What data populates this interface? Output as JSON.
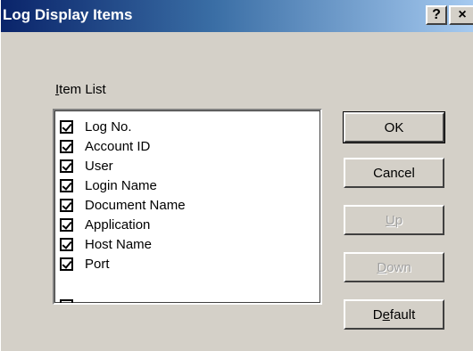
{
  "window": {
    "title": "Log Display Items",
    "help_label": "?",
    "close_label": "×"
  },
  "item_list": {
    "label_mnemonic": "I",
    "label_rest": "tem List",
    "items": [
      {
        "label": "Log No.",
        "checked": true
      },
      {
        "label": "Account ID",
        "checked": true
      },
      {
        "label": "User",
        "checked": true
      },
      {
        "label": "Login Name",
        "checked": true
      },
      {
        "label": "Document Name",
        "checked": true
      },
      {
        "label": "Application",
        "checked": true
      },
      {
        "label": "Host Name",
        "checked": true
      },
      {
        "label": "Port",
        "checked": true
      }
    ]
  },
  "buttons": {
    "ok": "OK",
    "cancel": "Cancel",
    "up_mnemonic": "U",
    "up_rest": "p",
    "down_mnemonic": "D",
    "down_rest": "own",
    "default_pre": "D",
    "default_mnemonic": "e",
    "default_rest": "fault"
  },
  "colors": {
    "dialog_face": "#d4d0c8",
    "title_gradient_start": "#0a246a",
    "title_gradient_end": "#a6caf0",
    "disabled_text": "#a0a0a0"
  }
}
